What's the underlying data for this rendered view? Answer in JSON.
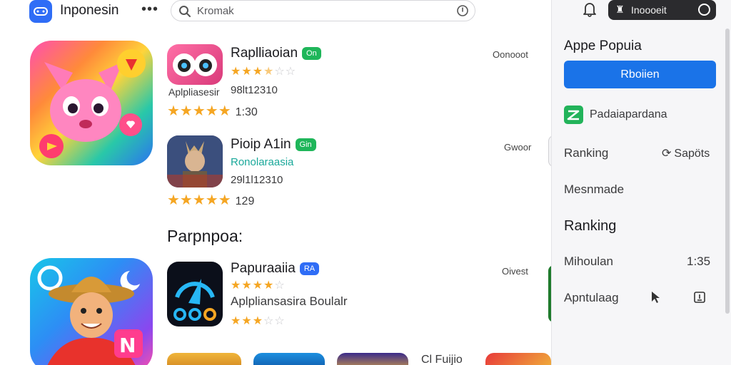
{
  "header": {
    "app_title": "Inponesin",
    "more_label": "•••",
    "search_placeholder": "Kromak",
    "logo_icon": "controller-icon",
    "search_icon": "search-icon",
    "mic_icon": "voice-icon"
  },
  "apps": [
    {
      "name": "Raplliaoian",
      "badge": "On",
      "line1": "Aplpliasesir",
      "line2": "98lt12310",
      "rating_stars_small": 3.5,
      "rating_stars_large": 5,
      "rating_number": "1:30",
      "get_label": "Oonooot"
    },
    {
      "name": "Pioip A1in",
      "badge": "Gin",
      "line1": "Ronolaraasia",
      "line2": "29l1l12310",
      "rating_stars_large": 5,
      "rating_number": "129",
      "get_label": "Gwoor"
    },
    {
      "name": "Papuraaiia",
      "badge": "RA",
      "line1": "Aplpliansasira Boulalr",
      "rating_stars_small": 4,
      "rating_stars_small2": 3,
      "get_label": "Oivest"
    }
  ],
  "section_heading": "Parpnpoa:",
  "bottom_partial_label": "Cl Fuijio",
  "panel": {
    "account_text": "Inoooeit",
    "title": "Appe Popuia",
    "primary_button": "Rboiien",
    "row_icon_text": "Padaiapardana",
    "row_ranking_1": "Ranking",
    "row_ranking_1_side": "Sapöts",
    "row_message": "Mesnmade",
    "row_ranking_2": "Ranking",
    "row_minolan": "Mihoulan",
    "row_minolan_value": "1:35",
    "row_apntulag": "Apntulaag"
  },
  "colors": {
    "accent_blue": "#1a73e8",
    "star": "#f5a623",
    "badge_green": "#1fb65a",
    "teal_text": "#1aa89a"
  }
}
